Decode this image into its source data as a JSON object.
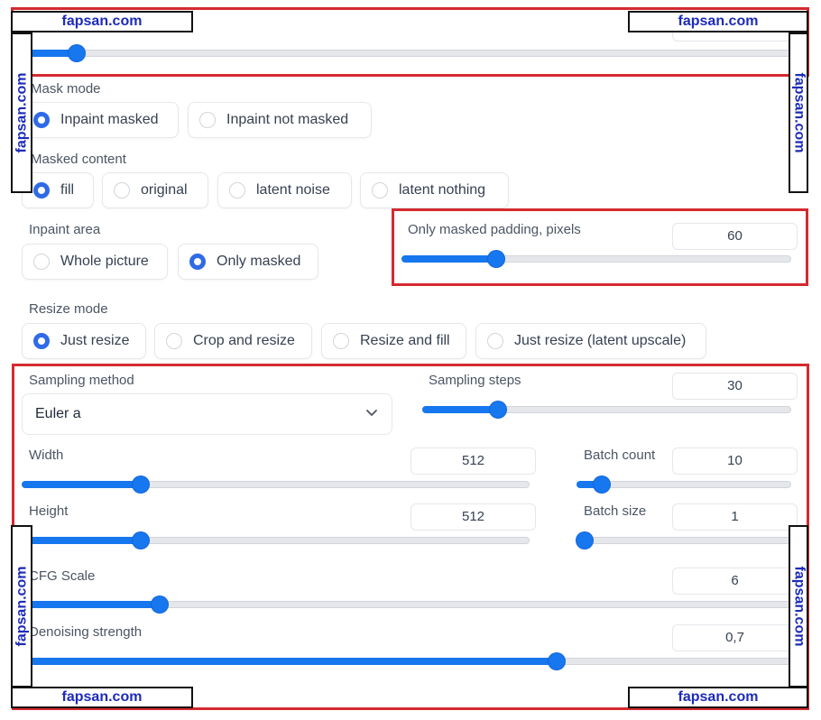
{
  "top_slider": {
    "name": "top-slider",
    "value": 0.07
  },
  "mask_mode": {
    "label": "Mask mode",
    "options": [
      "Inpaint masked",
      "Inpaint not masked"
    ],
    "selected": "Inpaint masked"
  },
  "masked_content": {
    "label": "Masked content",
    "options": [
      "fill",
      "original",
      "latent noise",
      "latent nothing"
    ],
    "selected": "fill"
  },
  "inpaint_area": {
    "label": "Inpaint area",
    "options": [
      "Whole picture",
      "Only masked"
    ],
    "selected": "Only masked"
  },
  "only_masked_padding": {
    "label": "Only masked padding, pixels",
    "value": "60",
    "fraction": 0.24
  },
  "resize_mode": {
    "label": "Resize mode",
    "options": [
      "Just resize",
      "Crop and resize",
      "Resize and fill",
      "Just resize (latent upscale)"
    ],
    "selected": "Just resize"
  },
  "sampling_method": {
    "label": "Sampling method",
    "value": "Euler a"
  },
  "sampling_steps": {
    "label": "Sampling steps",
    "value": "30",
    "fraction": 0.2
  },
  "width": {
    "label": "Width",
    "value": "512",
    "fraction": 0.23
  },
  "height": {
    "label": "Height",
    "value": "512",
    "fraction": 0.23
  },
  "batch_count": {
    "label": "Batch count",
    "value": "10",
    "fraction": 0.11
  },
  "batch_size": {
    "label": "Batch size",
    "value": "1",
    "fraction": 0.0
  },
  "cfg_scale": {
    "label": "CFG Scale",
    "value": "6",
    "fraction": 0.17
  },
  "denoising_strength": {
    "label": "Denoising strength",
    "value": "0,7",
    "fraction": 0.7
  },
  "watermark": {
    "text": "fapsan.com"
  },
  "colors": {
    "accent": "#1677ee",
    "highlight_frame": "#d42a2f",
    "watermark_text": "#1d2bb8"
  }
}
